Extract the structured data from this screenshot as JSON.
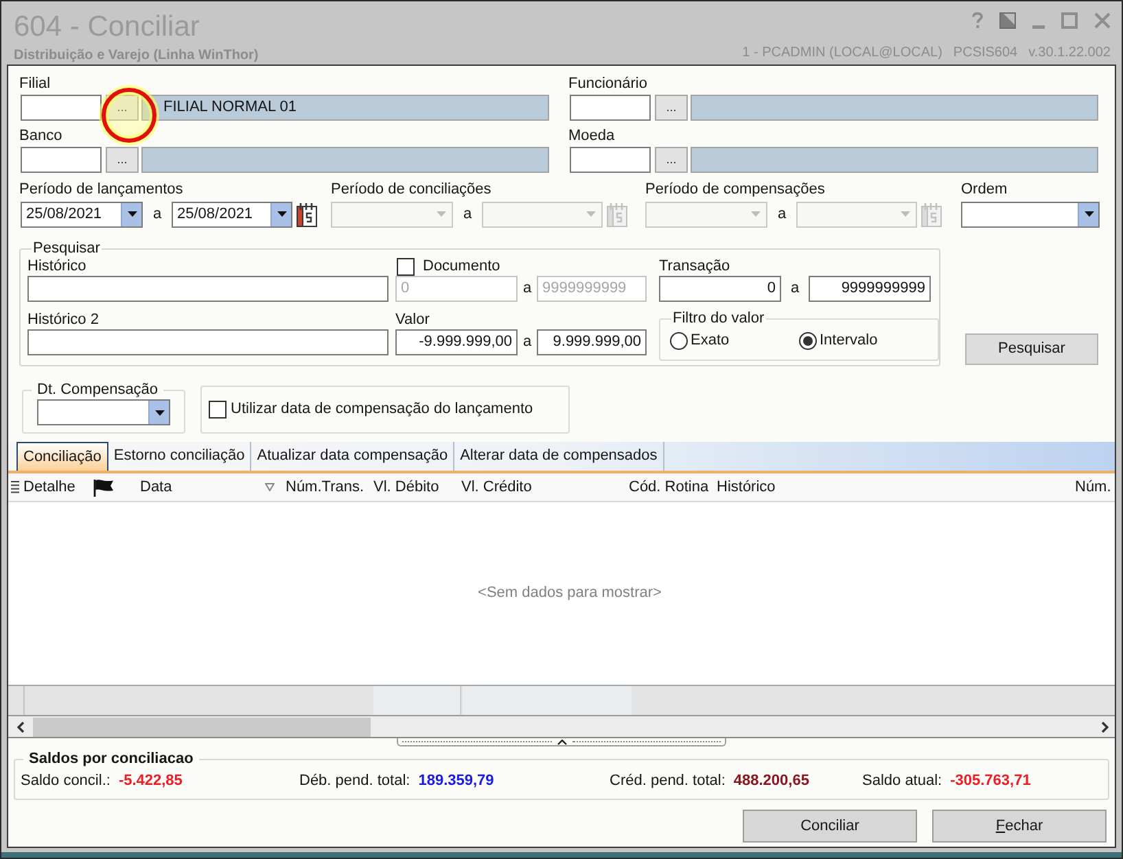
{
  "window": {
    "title": "604 - Conciliar",
    "subtitle": "Distribuição e Varejo (Linha WinThor)",
    "session": "1 - PCADMIN (LOCAL@LOCAL)",
    "program": "PCSIS604",
    "version": "v.30.1.22.002"
  },
  "lookups": [
    {
      "label": "Filial",
      "button": "...",
      "description": "FILIAL NORMAL 01",
      "highlighted": true
    },
    {
      "label": "Funcionário",
      "button": "...",
      "highlighted": false
    },
    {
      "label": "Banco",
      "button": "...",
      "highlighted": false
    },
    {
      "label": "Moeda",
      "button": "...",
      "highlighted": false
    }
  ],
  "periods": [
    {
      "label": "Período de lançamentos",
      "from": "25/08/2021",
      "separator": "a",
      "to": "25/08/2021",
      "disabled": false
    },
    {
      "label": "Período de conciliações",
      "separator": "a",
      "disabled": true
    },
    {
      "label": "Período de compensações",
      "separator": "a",
      "disabled": true
    }
  ],
  "order": {
    "label": "Ordem"
  },
  "search": {
    "title": "Pesquisar",
    "history": {
      "label": "Histórico"
    },
    "document": {
      "label": "Documento",
      "checked": false,
      "from": "0",
      "separator": "a",
      "to": "9999999999"
    },
    "transaction": {
      "label": "Transação",
      "from": "0",
      "separator": "a",
      "to": "9999999999"
    },
    "history_2": {
      "label": "Histórico 2"
    },
    "amount": {
      "label": "Valor",
      "from": "-9.999.999,00",
      "separator": "a",
      "to": "9.999.999,00"
    },
    "amount_filter": {
      "title": "Filtro do valor",
      "options": [
        {
          "label": "Exato",
          "selected": false
        },
        {
          "label": "Intervalo",
          "selected": true
        }
      ]
    },
    "button": "Pesquisar"
  },
  "compensation_date": {
    "title": "Dt. Compensação"
  },
  "use_posting_date": {
    "label": "Utilizar data de compensação do lançamento",
    "checked": false
  },
  "tabs": [
    {
      "label": "Conciliação",
      "selected": true
    },
    {
      "label": "Estorno conciliação",
      "selected": false
    },
    {
      "label": "Atualizar data compensação",
      "selected": false
    },
    {
      "label": "Alterar data de compensados",
      "selected": false
    }
  ],
  "grid": {
    "columns": [
      {
        "kind": "text",
        "label": "Detalhe",
        "filter": false
      },
      {
        "kind": "flag",
        "filter": false
      },
      {
        "kind": "text",
        "label": "Data",
        "filter": true
      },
      {
        "kind": "text",
        "label": "Núm.Trans.",
        "filter": false
      },
      {
        "kind": "text",
        "label": "Vl. Débito",
        "filter": false
      },
      {
        "kind": "text",
        "label": "Vl. Crédito",
        "filter": false
      },
      {
        "kind": "text",
        "label": "Cód. Rotina",
        "filter": false
      },
      {
        "kind": "text",
        "label": "Histórico",
        "filter": false
      },
      {
        "kind": "text",
        "label": "Núm.",
        "filter": false
      }
    ],
    "empty_text": "<Sem dados para mostrar>"
  },
  "balances": {
    "title": "Saldos por conciliacao",
    "items": [
      {
        "label": "Saldo concil.:",
        "value": "-5.422,85",
        "color": "#ee1c24"
      },
      {
        "label": "Déb. pend. total:",
        "value": "189.359,79",
        "color": "#1a1ae0"
      },
      {
        "label": "Créd. pend. total:",
        "value": "488.200,65",
        "color": "#8c1420"
      },
      {
        "label": "Saldo atual:",
        "value": "-305.763,71",
        "color": "#ee1c24"
      }
    ]
  },
  "buttons": [
    {
      "label": "Conciliar",
      "mnemonic": false
    },
    {
      "label": "Fechar",
      "mnemonic": true
    }
  ]
}
